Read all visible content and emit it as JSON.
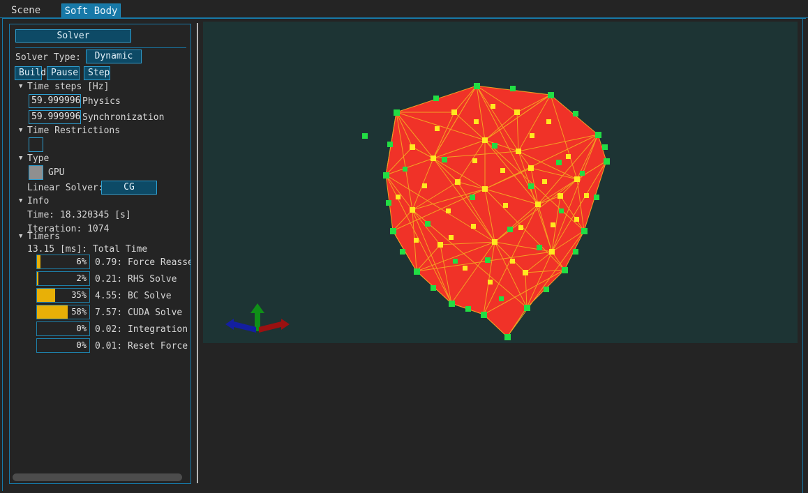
{
  "window": {
    "accent_color": "#1779a8",
    "background": "#242424",
    "panel_border": "#2d9ed0"
  },
  "tabs": [
    {
      "label": "Scene",
      "active": false
    },
    {
      "label": "Soft Body",
      "active": true
    }
  ],
  "panel": {
    "section_title": "Solver",
    "solver_type": {
      "label": "Solver Type:",
      "value": "Dynamic"
    },
    "actions": [
      {
        "label": "Build"
      },
      {
        "label": "Pause"
      },
      {
        "label": "Step"
      }
    ],
    "time_steps": {
      "title": "Time steps [Hz]",
      "expanded": true,
      "fields": [
        {
          "value": "59.999996",
          "label": "Physics"
        },
        {
          "value": "59.999996",
          "label": "Synchronization"
        }
      ]
    },
    "time_restrictions": {
      "title": "Time Restrictions",
      "expanded": true,
      "checkbox_checked": false
    },
    "type": {
      "title": "Type",
      "expanded": true,
      "gpu": {
        "label": "GPU",
        "checked": true
      },
      "linear_solver": {
        "label": "Linear Solver:",
        "value": "CG"
      }
    },
    "info": {
      "title": "Info",
      "expanded": true,
      "time": "Time: 18.320345 [s]",
      "iteration": "Iteration: 1074"
    },
    "timers": {
      "title": "Timers",
      "expanded": true,
      "total": "13.15 [ms]: Total Time",
      "bar_fill_color": "#e8b007",
      "rows": [
        {
          "percent": 6,
          "percent_label": "6%",
          "time": "0.79",
          "name": "Force Reassembl•"
        },
        {
          "percent": 2,
          "percent_label": "2%",
          "time": "0.21",
          "name": "RHS Solve"
        },
        {
          "percent": 35,
          "percent_label": "35%",
          "time": "4.55",
          "name": "BC Solve"
        },
        {
          "percent": 58,
          "percent_label": "58%",
          "time": "7.57",
          "name": "CUDA Solve"
        },
        {
          "percent": 0,
          "percent_label": "0%",
          "time": "0.02",
          "name": "Integration Sol•"
        },
        {
          "percent": 0,
          "percent_label": "0%",
          "time": "0.01",
          "name": "Reset Force"
        }
      ]
    },
    "scrollbars": {
      "horizontal_present": true,
      "vertical_present": true
    }
  },
  "viewport": {
    "background_color": "#1d3434",
    "mesh": {
      "face_color": "#f03228",
      "edge_color": "#f5a623",
      "surface_vertex_color": "#22dd44",
      "interior_vertex_color": "#ffe920",
      "description": "soft body tetrahedral mesh"
    },
    "axis_gizmo": {
      "x_color": "#9b1111",
      "y_color": "#0f8f18",
      "z_color": "#141fa0"
    }
  }
}
